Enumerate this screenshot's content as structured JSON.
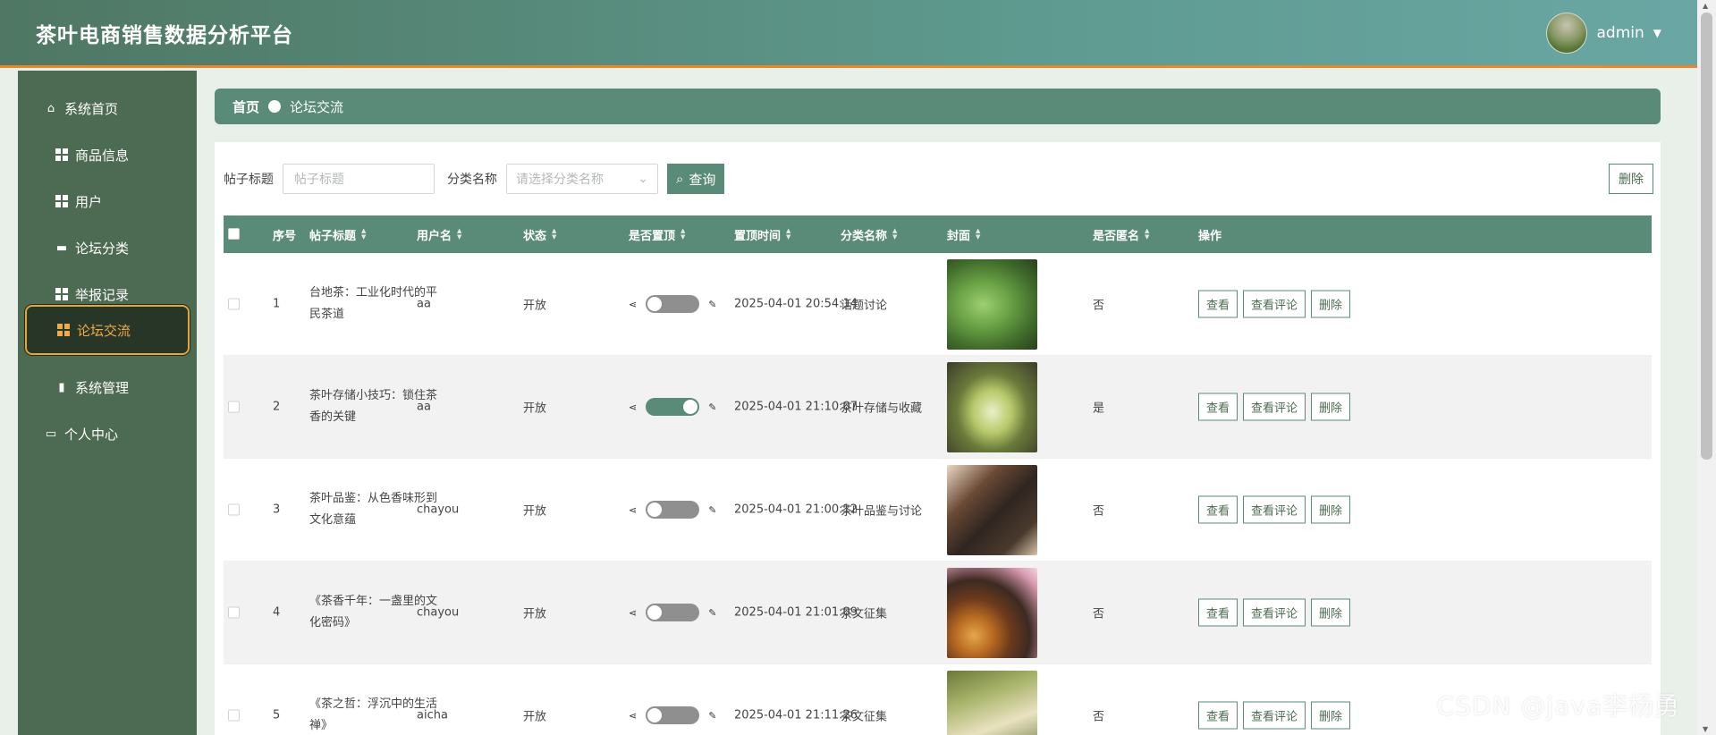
{
  "header": {
    "title": "茶叶电商销售数据分析平台",
    "username": "admin"
  },
  "sidebar": {
    "items": [
      {
        "label": "系统首页",
        "icon": "home-icon"
      },
      {
        "label": "商品信息",
        "icon": "grid-icon"
      },
      {
        "label": "用户",
        "icon": "grid-icon"
      },
      {
        "label": "论坛分类",
        "icon": "ticket-icon"
      },
      {
        "label": "举报记录",
        "icon": "grid-icon"
      },
      {
        "label": "论坛交流",
        "icon": "grid-icon",
        "active": true
      },
      {
        "label": "系统管理",
        "icon": "bar-chart-icon"
      },
      {
        "label": "个人中心",
        "icon": "card-icon"
      }
    ]
  },
  "breadcrumb": {
    "home": "首页",
    "current": "论坛交流"
  },
  "search": {
    "title_label": "帖子标题",
    "title_placeholder": "帖子标题",
    "category_label": "分类名称",
    "category_placeholder": "请选择分类名称",
    "query_label": "查询",
    "delete_label": "删除"
  },
  "table": {
    "headers": {
      "index": "序号",
      "title": "帖子标题",
      "username": "用户名",
      "status": "状态",
      "pinned": "是否置顶",
      "pinned_time": "置顶时间",
      "category": "分类名称",
      "cover": "封面",
      "anonymous": "是否匿名",
      "actions": "操作"
    },
    "action_labels": {
      "view": "查看",
      "view_comments": "查看评论",
      "delete": "删除"
    },
    "rows": [
      {
        "index": "1",
        "title": "台地茶：工业化时代的平民茶道",
        "username": "aa",
        "status": "开放",
        "pinned": false,
        "pinned_time": "2025-04-01 20:54:14",
        "category": "话题讨论",
        "anonymous": "否"
      },
      {
        "index": "2",
        "title": "茶叶存储小技巧：锁住茶香的关键",
        "username": "aa",
        "status": "开放",
        "pinned": true,
        "pinned_time": "2025-04-01 21:10:07",
        "category": "茶叶存储与收藏",
        "anonymous": "是"
      },
      {
        "index": "3",
        "title": "茶叶品鉴：从色香味形到文化意蕴",
        "username": "chayou",
        "status": "开放",
        "pinned": false,
        "pinned_time": "2025-04-01 21:00:12",
        "category": "茶叶品鉴与讨论",
        "anonymous": "否"
      },
      {
        "index": "4",
        "title": "《茶香千年：一盏里的文化密码》",
        "username": "chayou",
        "status": "开放",
        "pinned": false,
        "pinned_time": "2025-04-01 21:01:09",
        "category": "茶文征集",
        "anonymous": "否"
      },
      {
        "index": "5",
        "title": "《茶之哲：浮沉中的生活禅》",
        "username": "aicha",
        "status": "开放",
        "pinned": false,
        "pinned_time": "2025-04-01 21:11:26",
        "category": "茶文征集",
        "anonymous": "否"
      }
    ]
  },
  "watermark": "CSDN @java李杨勇",
  "colors": {
    "primary": "#5a8a78",
    "sidebar": "#4d6b52",
    "accent": "#e8872b"
  }
}
